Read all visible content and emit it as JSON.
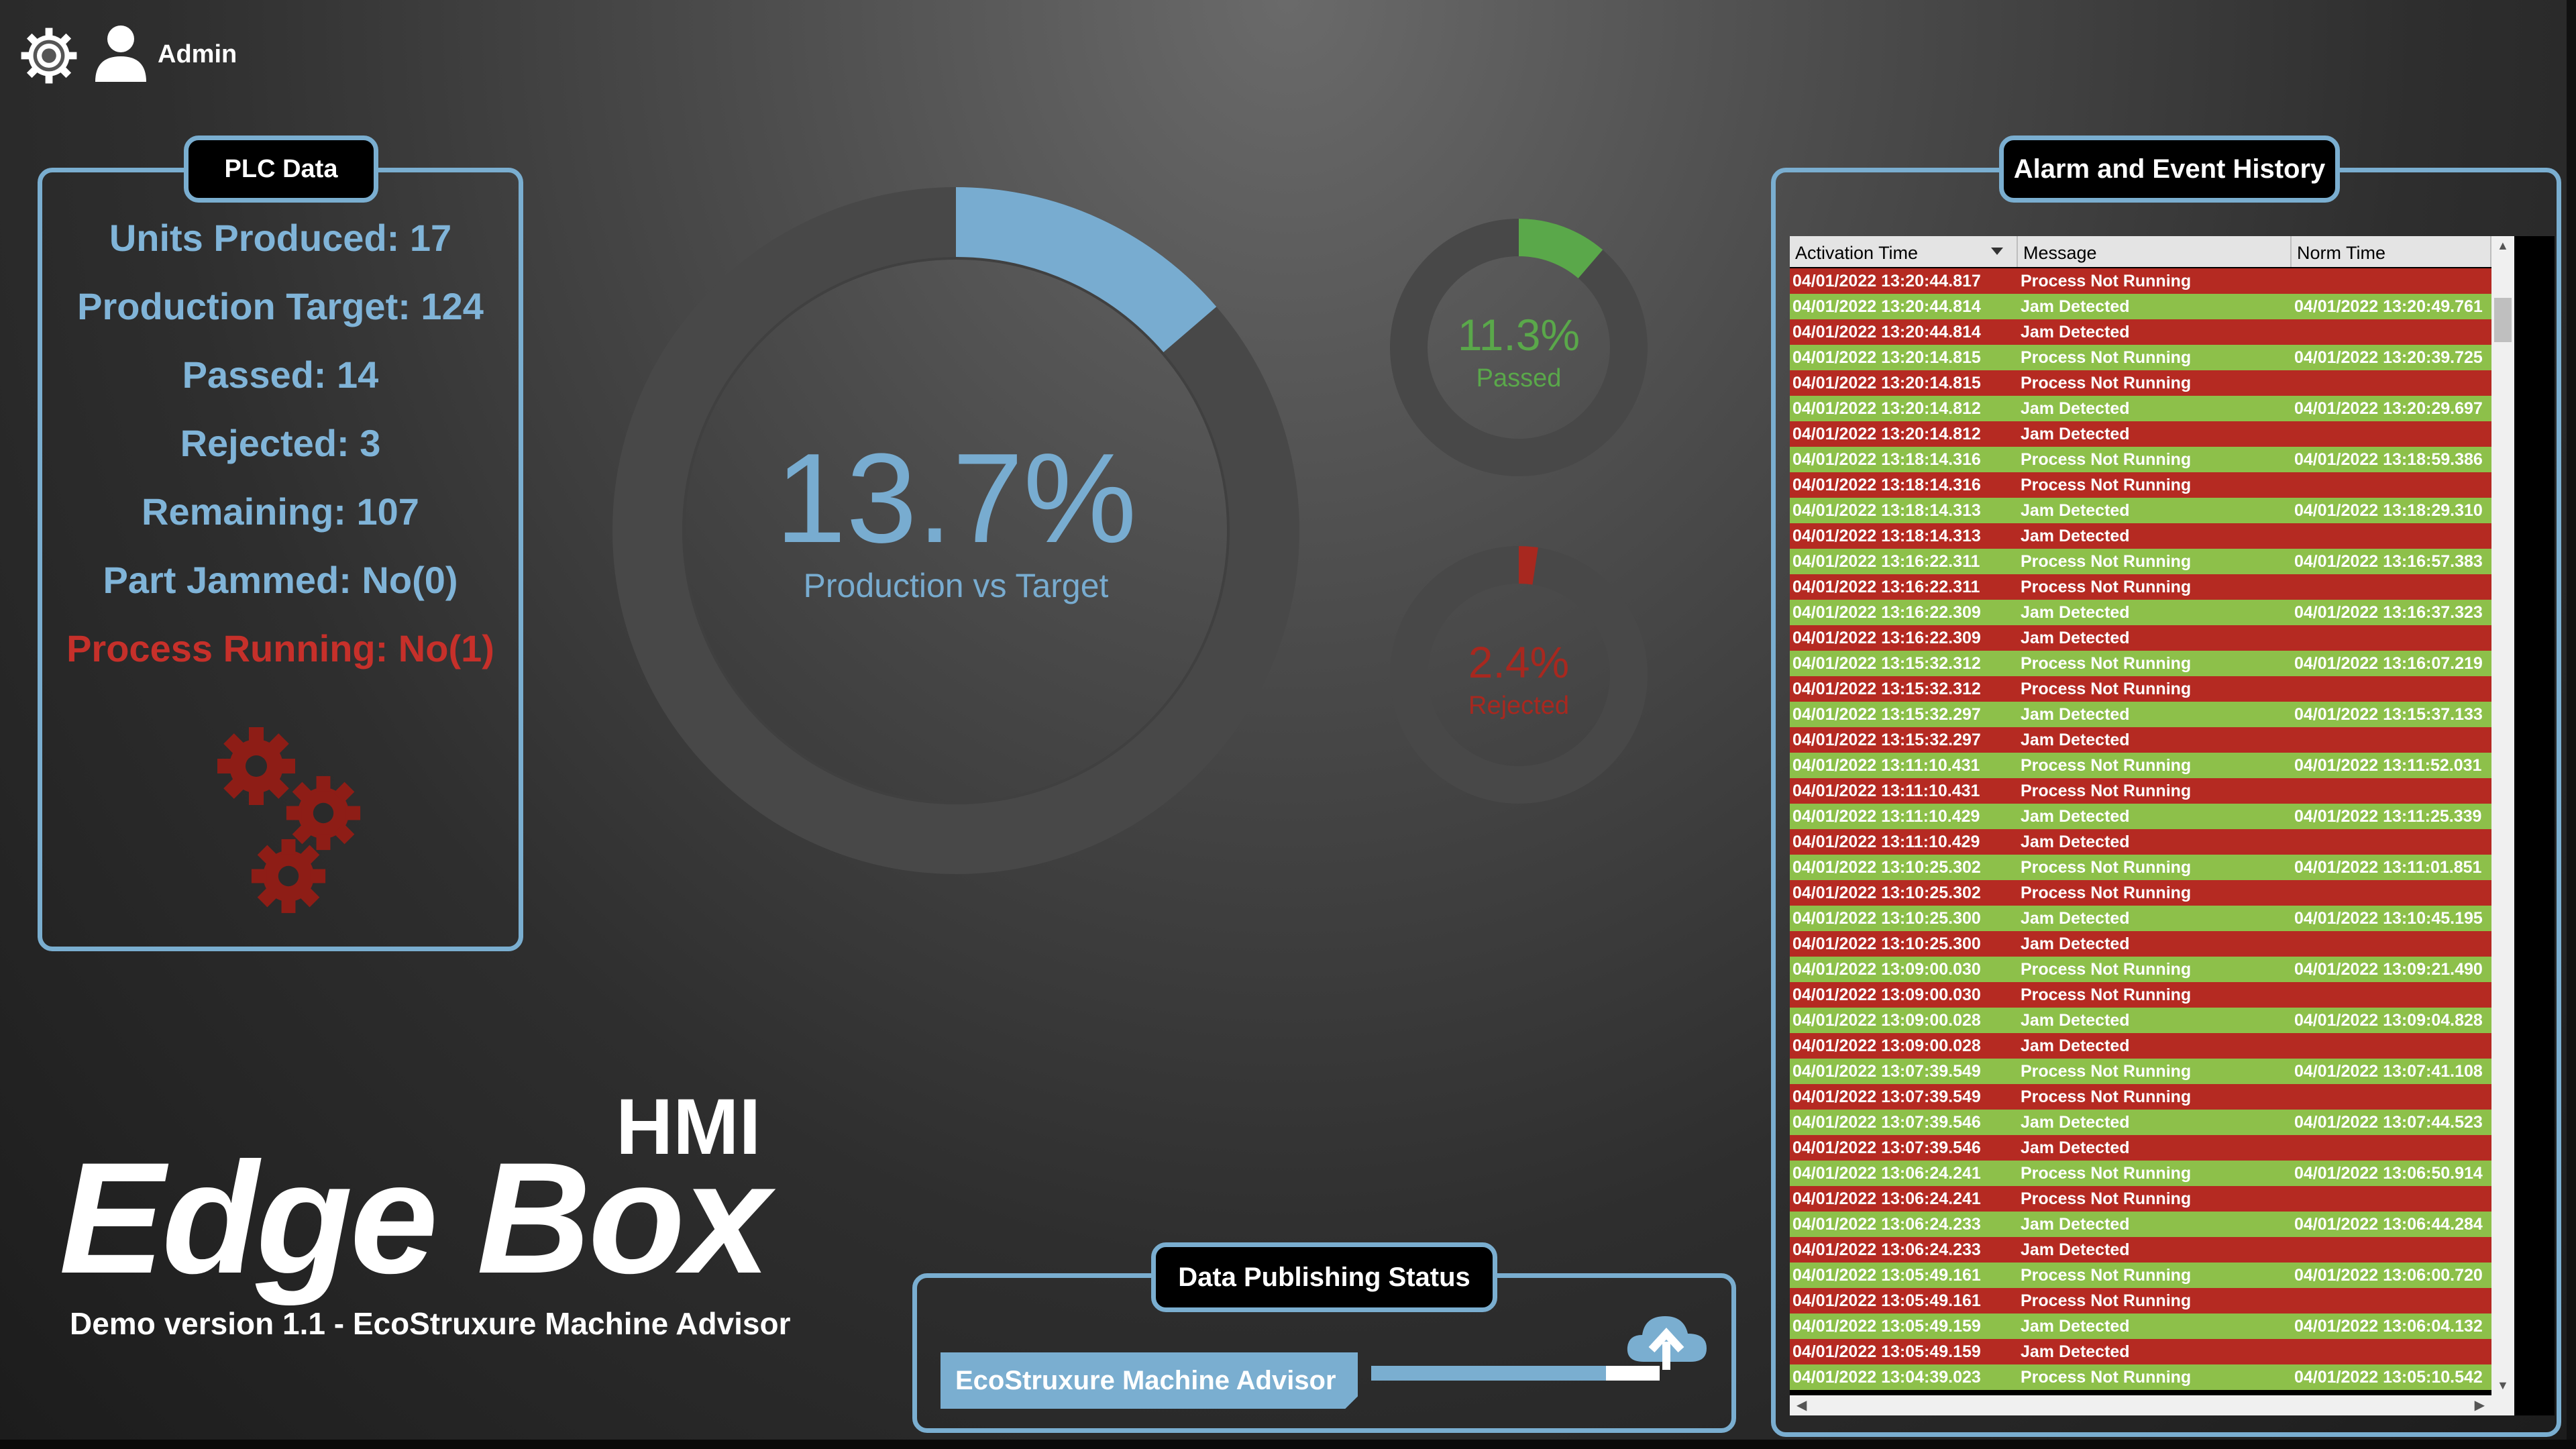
{
  "header": {
    "user_name": "Admin"
  },
  "plc": {
    "title": "PLC Data",
    "units_produced": "Units Produced: 17",
    "production_target": "Production Target: 124",
    "passed": "Passed: 14",
    "rejected": "Rejected: 3",
    "remaining": "Remaining: 107",
    "part_jammed": "Part Jammed: No(0)",
    "process_running": "Process Running: No(1)"
  },
  "gauges": {
    "main": {
      "value_text": "13.7%",
      "label": "Production vs Target",
      "fraction": 0.137,
      "color": "#78acd0"
    },
    "passed": {
      "value_text": "11.3%",
      "label": "Passed",
      "fraction": 0.113,
      "color": "#5aa84a"
    },
    "rejected": {
      "value_text": "2.4%",
      "label": "Rejected",
      "fraction": 0.024,
      "color": "#a8281f"
    }
  },
  "branding": {
    "hmi": "HMI",
    "brand": "Edge Box",
    "demo": "Demo version 1.1 - EcoStruxure Machine Advisor"
  },
  "publishing": {
    "title": "Data Publishing Status",
    "label": "EcoStruxure Machine Advisor"
  },
  "alarms": {
    "title": "Alarm and Event History",
    "columns": [
      "Activation Time",
      "Message",
      "Norm Time"
    ],
    "rows": [
      [
        "04/01/2022 13:20:44.817",
        "Process Not Running",
        "",
        "red"
      ],
      [
        "04/01/2022 13:20:44.814",
        "Jam Detected",
        "04/01/2022 13:20:49.761",
        "green"
      ],
      [
        "04/01/2022 13:20:44.814",
        "Jam Detected",
        "",
        "red"
      ],
      [
        "04/01/2022 13:20:14.815",
        "Process Not Running",
        "04/01/2022 13:20:39.725",
        "green"
      ],
      [
        "04/01/2022 13:20:14.815",
        "Process Not Running",
        "",
        "red"
      ],
      [
        "04/01/2022 13:20:14.812",
        "Jam Detected",
        "04/01/2022 13:20:29.697",
        "green"
      ],
      [
        "04/01/2022 13:20:14.812",
        "Jam Detected",
        "",
        "red"
      ],
      [
        "04/01/2022 13:18:14.316",
        "Process Not Running",
        "04/01/2022 13:18:59.386",
        "green"
      ],
      [
        "04/01/2022 13:18:14.316",
        "Process Not Running",
        "",
        "red"
      ],
      [
        "04/01/2022 13:18:14.313",
        "Jam Detected",
        "04/01/2022 13:18:29.310",
        "green"
      ],
      [
        "04/01/2022 13:18:14.313",
        "Jam Detected",
        "",
        "red"
      ],
      [
        "04/01/2022 13:16:22.311",
        "Process Not Running",
        "04/01/2022 13:16:57.383",
        "green"
      ],
      [
        "04/01/2022 13:16:22.311",
        "Process Not Running",
        "",
        "red"
      ],
      [
        "04/01/2022 13:16:22.309",
        "Jam Detected",
        "04/01/2022 13:16:37.323",
        "green"
      ],
      [
        "04/01/2022 13:16:22.309",
        "Jam Detected",
        "",
        "red"
      ],
      [
        "04/01/2022 13:15:32.312",
        "Process Not Running",
        "04/01/2022 13:16:07.219",
        "green"
      ],
      [
        "04/01/2022 13:15:32.312",
        "Process Not Running",
        "",
        "red"
      ],
      [
        "04/01/2022 13:15:32.297",
        "Jam Detected",
        "04/01/2022 13:15:37.133",
        "green"
      ],
      [
        "04/01/2022 13:15:32.297",
        "Jam Detected",
        "",
        "red"
      ],
      [
        "04/01/2022 13:11:10.431",
        "Process Not Running",
        "04/01/2022 13:11:52.031",
        "green"
      ],
      [
        "04/01/2022 13:11:10.431",
        "Process Not Running",
        "",
        "red"
      ],
      [
        "04/01/2022 13:11:10.429",
        "Jam Detected",
        "04/01/2022 13:11:25.339",
        "green"
      ],
      [
        "04/01/2022 13:11:10.429",
        "Jam Detected",
        "",
        "red"
      ],
      [
        "04/01/2022 13:10:25.302",
        "Process Not Running",
        "04/01/2022 13:11:01.851",
        "green"
      ],
      [
        "04/01/2022 13:10:25.302",
        "Process Not Running",
        "",
        "red"
      ],
      [
        "04/01/2022 13:10:25.300",
        "Jam Detected",
        "04/01/2022 13:10:45.195",
        "green"
      ],
      [
        "04/01/2022 13:10:25.300",
        "Jam Detected",
        "",
        "red"
      ],
      [
        "04/01/2022 13:09:00.030",
        "Process Not Running",
        "04/01/2022 13:09:21.490",
        "green"
      ],
      [
        "04/01/2022 13:09:00.030",
        "Process Not Running",
        "",
        "red"
      ],
      [
        "04/01/2022 13:09:00.028",
        "Jam Detected",
        "04/01/2022 13:09:04.828",
        "green"
      ],
      [
        "04/01/2022 13:09:00.028",
        "Jam Detected",
        "",
        "red"
      ],
      [
        "04/01/2022 13:07:39.549",
        "Process Not Running",
        "04/01/2022 13:07:41.108",
        "green"
      ],
      [
        "04/01/2022 13:07:39.549",
        "Process Not Running",
        "",
        "red"
      ],
      [
        "04/01/2022 13:07:39.546",
        "Jam Detected",
        "04/01/2022 13:07:44.523",
        "green"
      ],
      [
        "04/01/2022 13:07:39.546",
        "Jam Detected",
        "",
        "red"
      ],
      [
        "04/01/2022 13:06:24.241",
        "Process Not Running",
        "04/01/2022 13:06:50.914",
        "green"
      ],
      [
        "04/01/2022 13:06:24.241",
        "Process Not Running",
        "",
        "red"
      ],
      [
        "04/01/2022 13:06:24.233",
        "Jam Detected",
        "04/01/2022 13:06:44.284",
        "green"
      ],
      [
        "04/01/2022 13:06:24.233",
        "Jam Detected",
        "",
        "red"
      ],
      [
        "04/01/2022 13:05:49.161",
        "Process Not Running",
        "04/01/2022 13:06:00.720",
        "green"
      ],
      [
        "04/01/2022 13:05:49.161",
        "Process Not Running",
        "",
        "red"
      ],
      [
        "04/01/2022 13:05:49.159",
        "Jam Detected",
        "04/01/2022 13:06:04.132",
        "green"
      ],
      [
        "04/01/2022 13:05:49.159",
        "Jam Detected",
        "",
        "red"
      ],
      [
        "04/01/2022 13:04:39.023",
        "Process Not Running",
        "04/01/2022 13:05:10.542",
        "green"
      ]
    ]
  }
}
